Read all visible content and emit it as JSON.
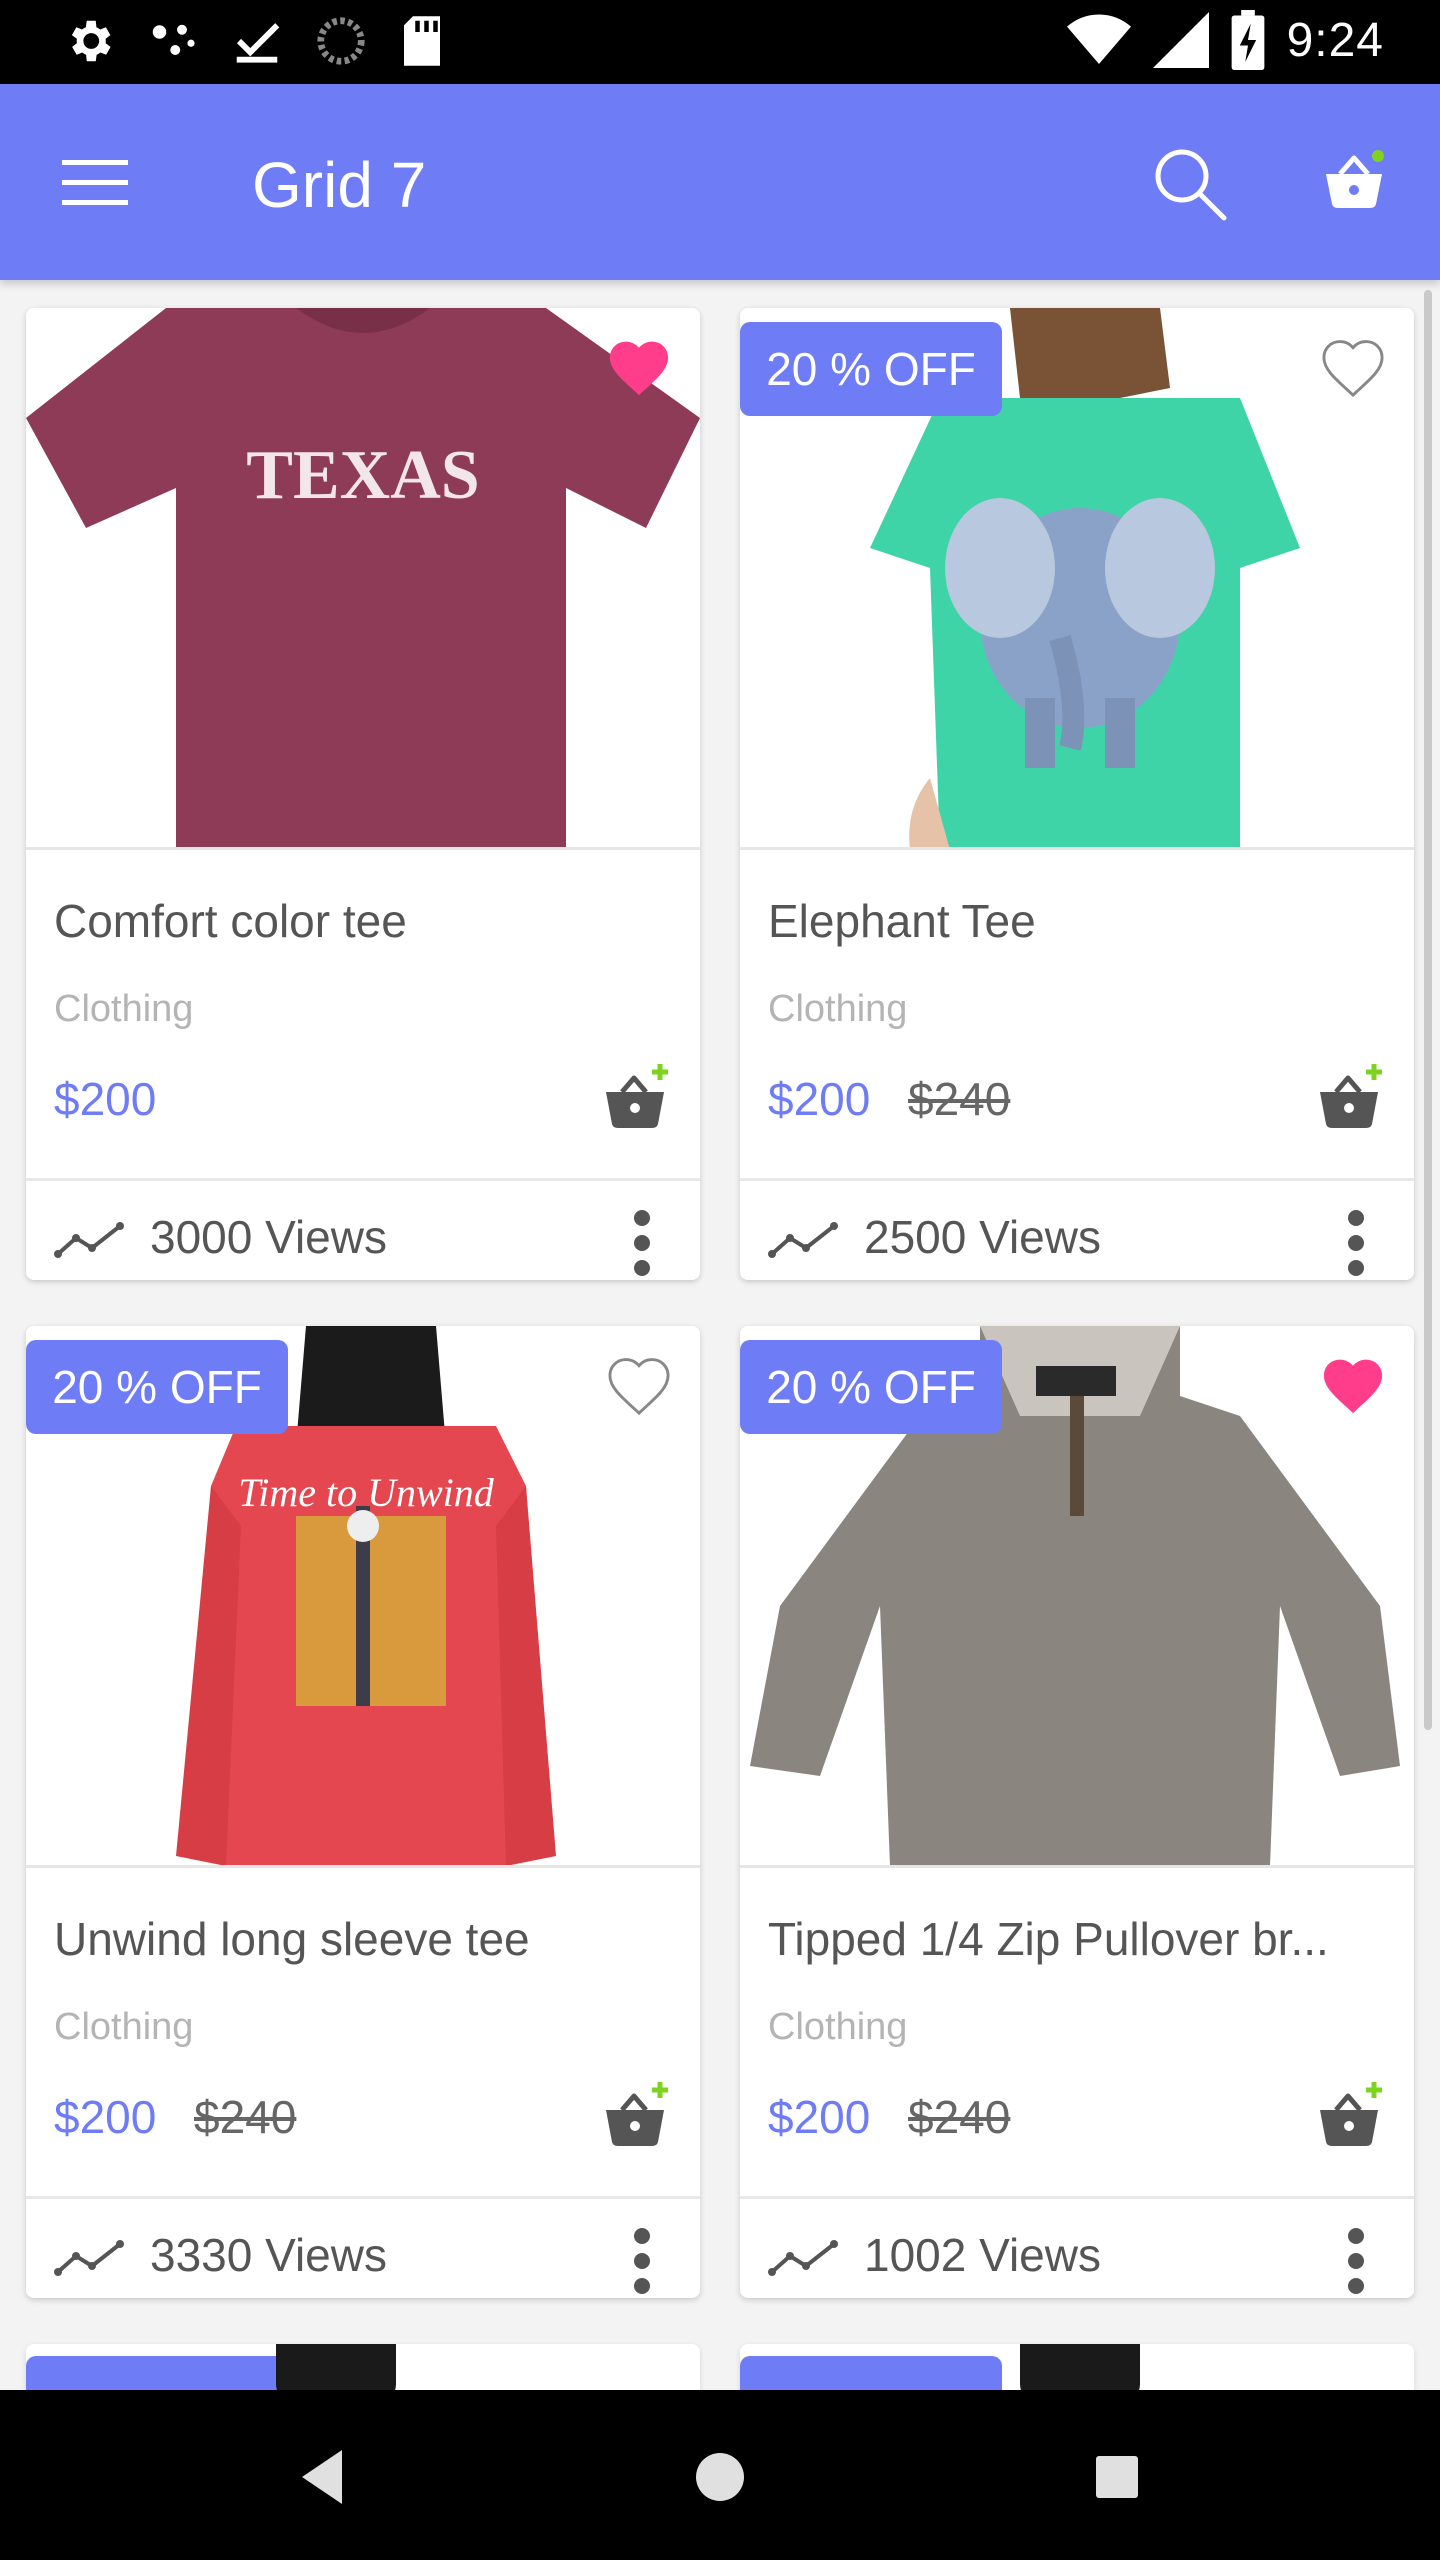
{
  "status_bar": {
    "time": "9:24"
  },
  "app_bar": {
    "title": "Grid 7",
    "icons": [
      "menu-icon",
      "search-icon",
      "cart-icon"
    ],
    "accent_color": "#6e7cf6",
    "cart_dot_color": "#7ed321"
  },
  "products": [
    {
      "name": "Comfort color tee",
      "category": "Clothing",
      "price": "$200",
      "old_price": "",
      "badge": "",
      "favorited": true,
      "views": "3000 Views"
    },
    {
      "name": "Elephant Tee",
      "category": "Clothing",
      "price": "$200",
      "old_price": "$240",
      "badge": "20 % OFF",
      "favorited": false,
      "views": "2500 Views"
    },
    {
      "name": "Unwind long sleeve tee",
      "category": "Clothing",
      "price": "$200",
      "old_price": "$240",
      "badge": "20 % OFF",
      "favorited": false,
      "views": "3330 Views"
    },
    {
      "name": "Tipped 1/4 Zip Pullover br...",
      "category": "Clothing",
      "price": "$200",
      "old_price": "$240",
      "badge": "20 % OFF",
      "favorited": true,
      "views": "1002 Views"
    }
  ],
  "colors": {
    "favorite_active": "#ff3d8b",
    "price": "#6e7cf6",
    "add_cart_plus": "#7ed321"
  }
}
